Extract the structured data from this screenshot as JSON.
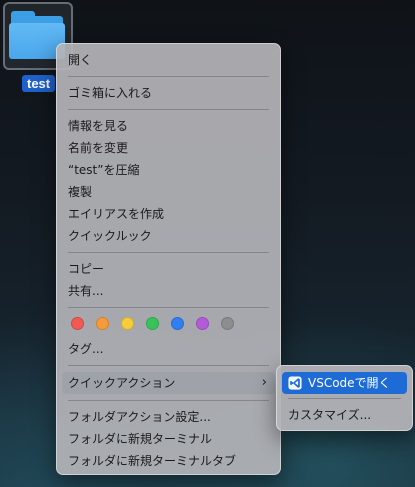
{
  "desktop": {
    "folder_label": "test"
  },
  "menu": {
    "open": "開く",
    "trash": "ゴミ箱に入れる",
    "get_info": "情報を見る",
    "rename": "名前を変更",
    "compress": "“test”を圧縮",
    "duplicate": "複製",
    "make_alias": "エイリアスを作成",
    "quick_look": "クイックルック",
    "copy": "コピー",
    "share": "共有...",
    "tag_colors": [
      "#f05a52",
      "#f59b3a",
      "#f6cc3a",
      "#38c35a",
      "#2f7ff0",
      "#b35ad8",
      "#8d8d8f"
    ],
    "tags": "タグ...",
    "quick_actions": "クイックアクション",
    "folder_action_setup": "フォルダアクション設定...",
    "new_terminal": "フォルダに新規ターミナル",
    "new_terminal_tab": "フォルダに新規ターミナルタブ"
  },
  "submenu": {
    "vscode": "VSCodeで開く",
    "customize": "カスタマイズ..."
  },
  "colors": {
    "highlight": "#1f6bd6",
    "folder": "#4aa7ec"
  }
}
